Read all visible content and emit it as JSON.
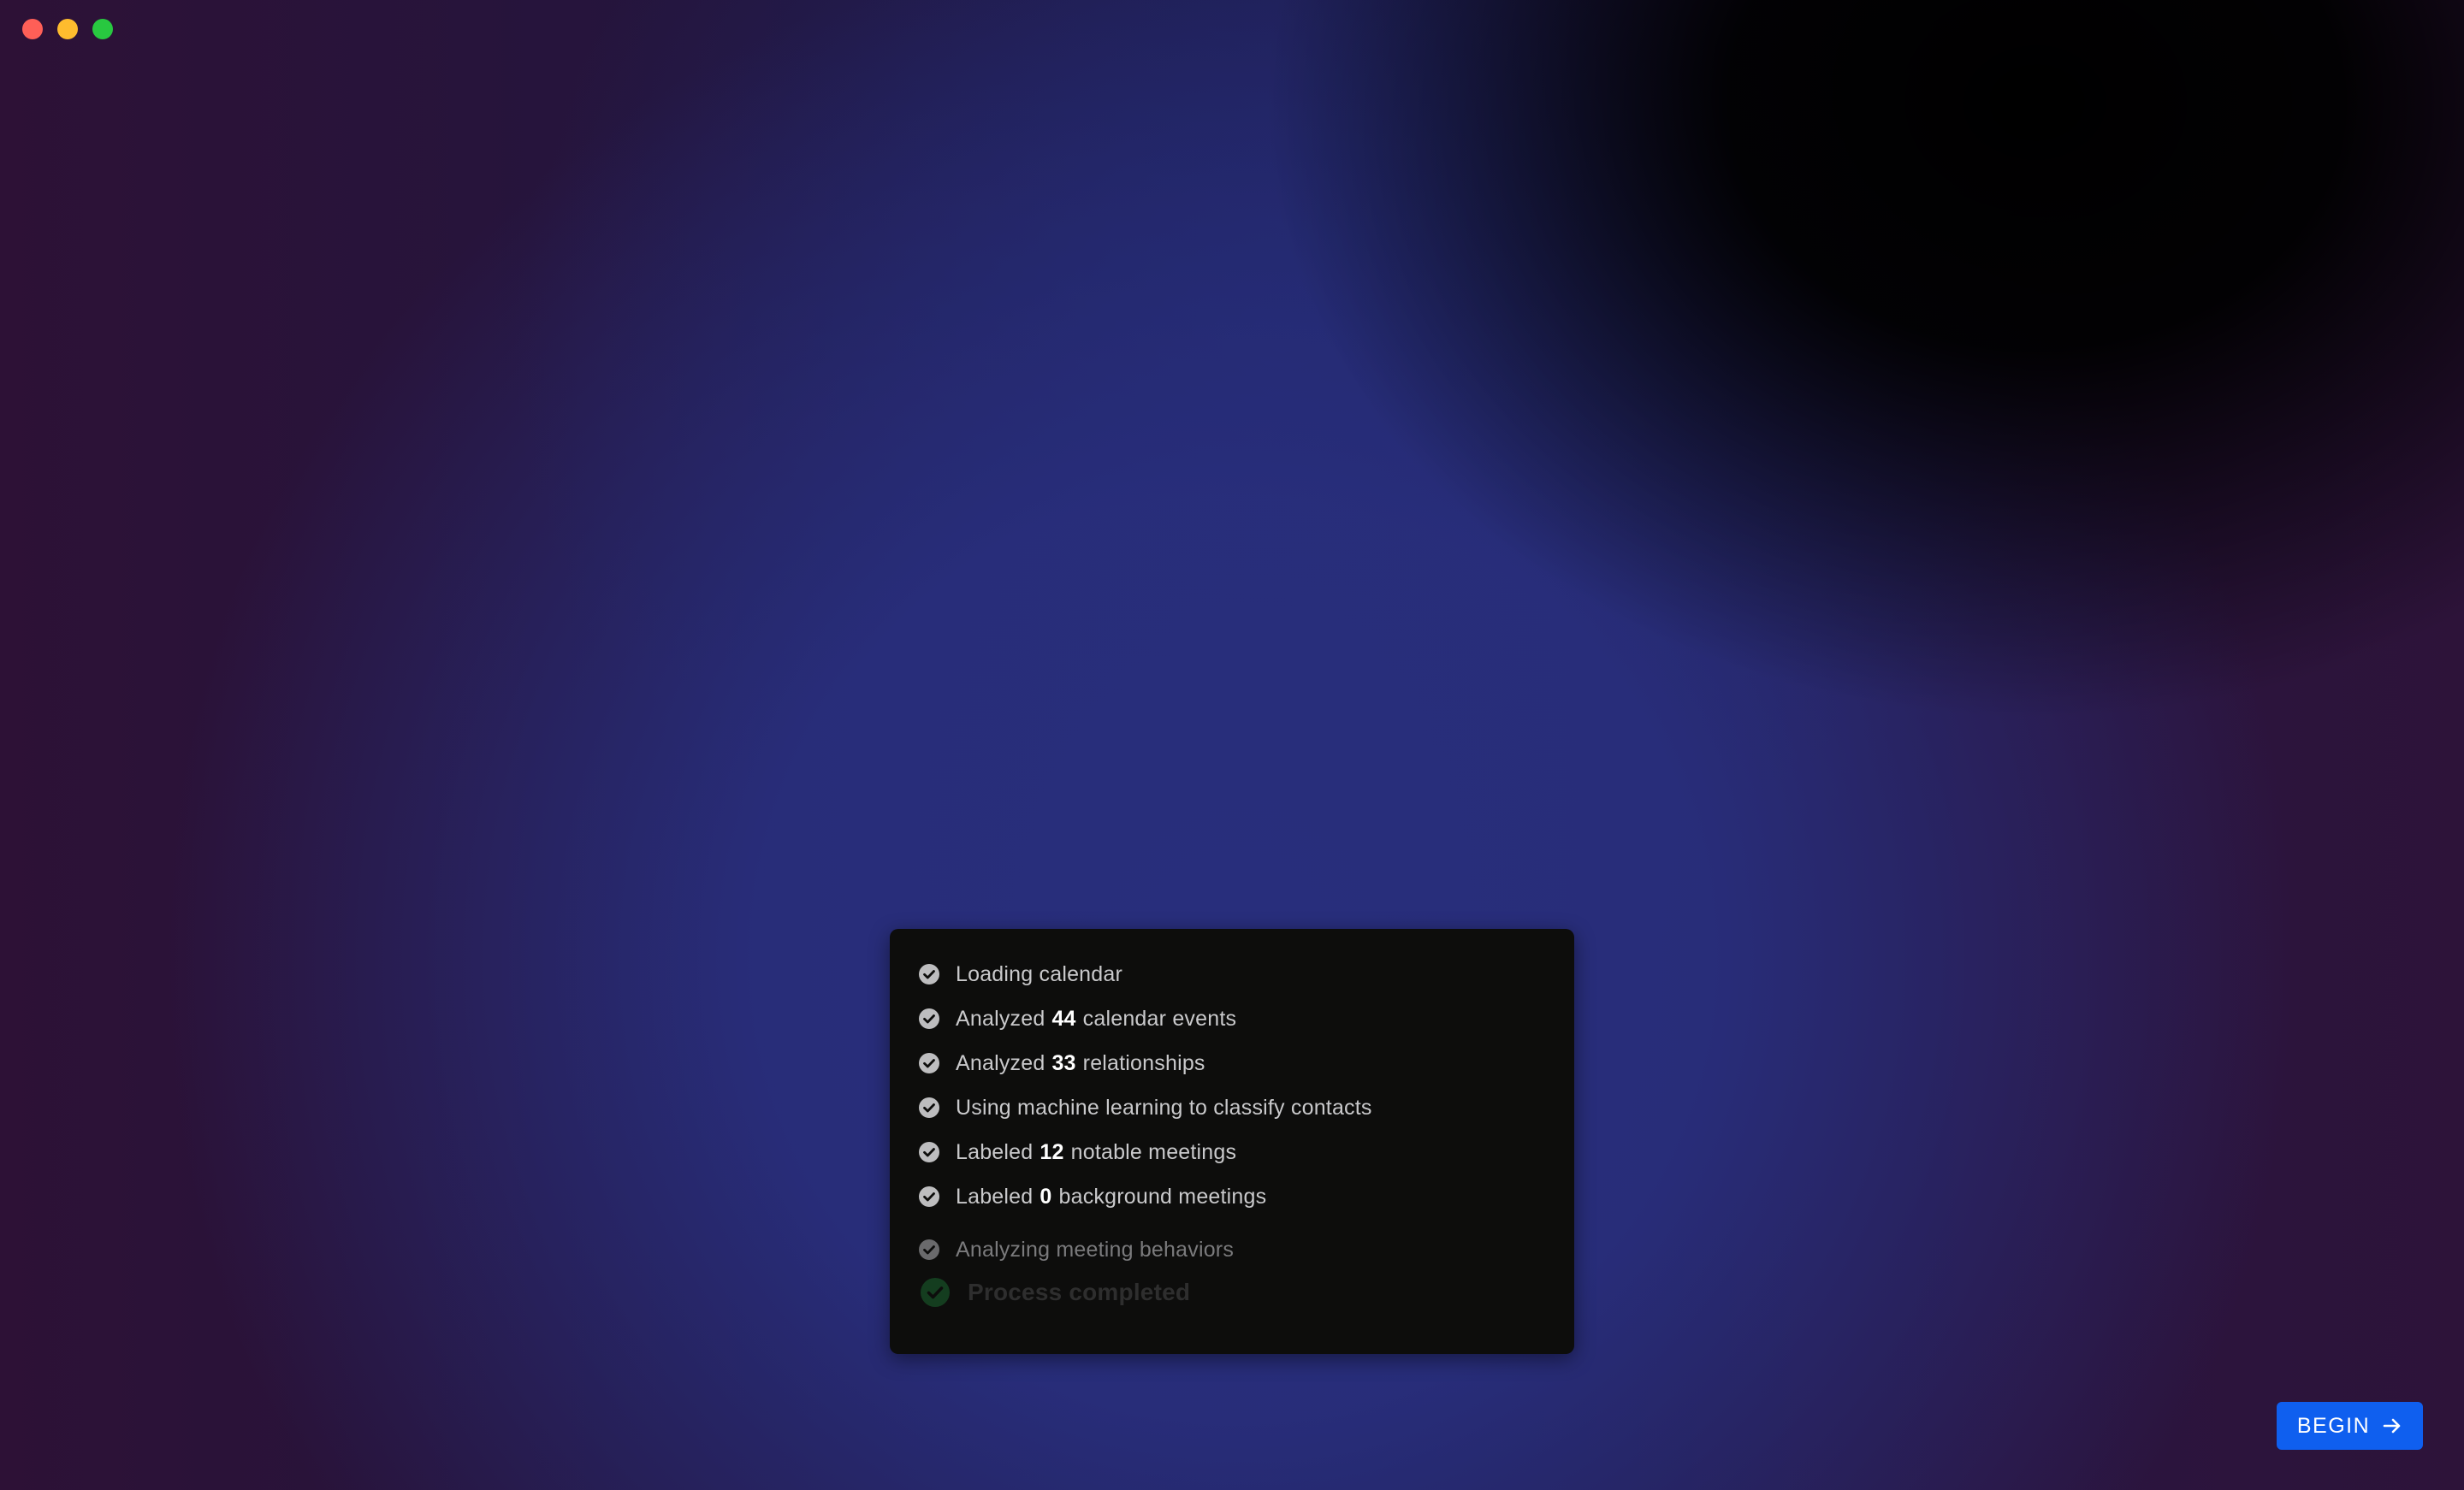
{
  "window": {
    "controls": [
      "close",
      "minimize",
      "maximize"
    ]
  },
  "progress": {
    "steps": [
      {
        "text": "Loading calendar",
        "state": "done"
      },
      {
        "pre": "Analyzed",
        "num": "44",
        "post": "calendar events",
        "state": "done"
      },
      {
        "pre": "Analyzed",
        "num": "33",
        "post": "relationships",
        "state": "done"
      },
      {
        "text": "Using machine learning to classify contacts",
        "state": "done"
      },
      {
        "pre": "Labeled",
        "num": "12",
        "post": "notable meetings",
        "state": "done"
      },
      {
        "pre": "Labeled",
        "num": "0",
        "post": "background meetings",
        "state": "done"
      },
      {
        "text": "Analyzing meeting behaviors",
        "state": "in-progress"
      },
      {
        "text": "Process completed",
        "state": "pending"
      }
    ]
  },
  "actions": {
    "begin_label": "BEGIN",
    "begin_icon": "arrow-right-icon"
  },
  "colors": {
    "accent": "#0f5fef",
    "panel_bg": "#0d0d0c",
    "close": "#fe5f57",
    "minimize": "#febc2e",
    "maximize": "#28c840"
  }
}
